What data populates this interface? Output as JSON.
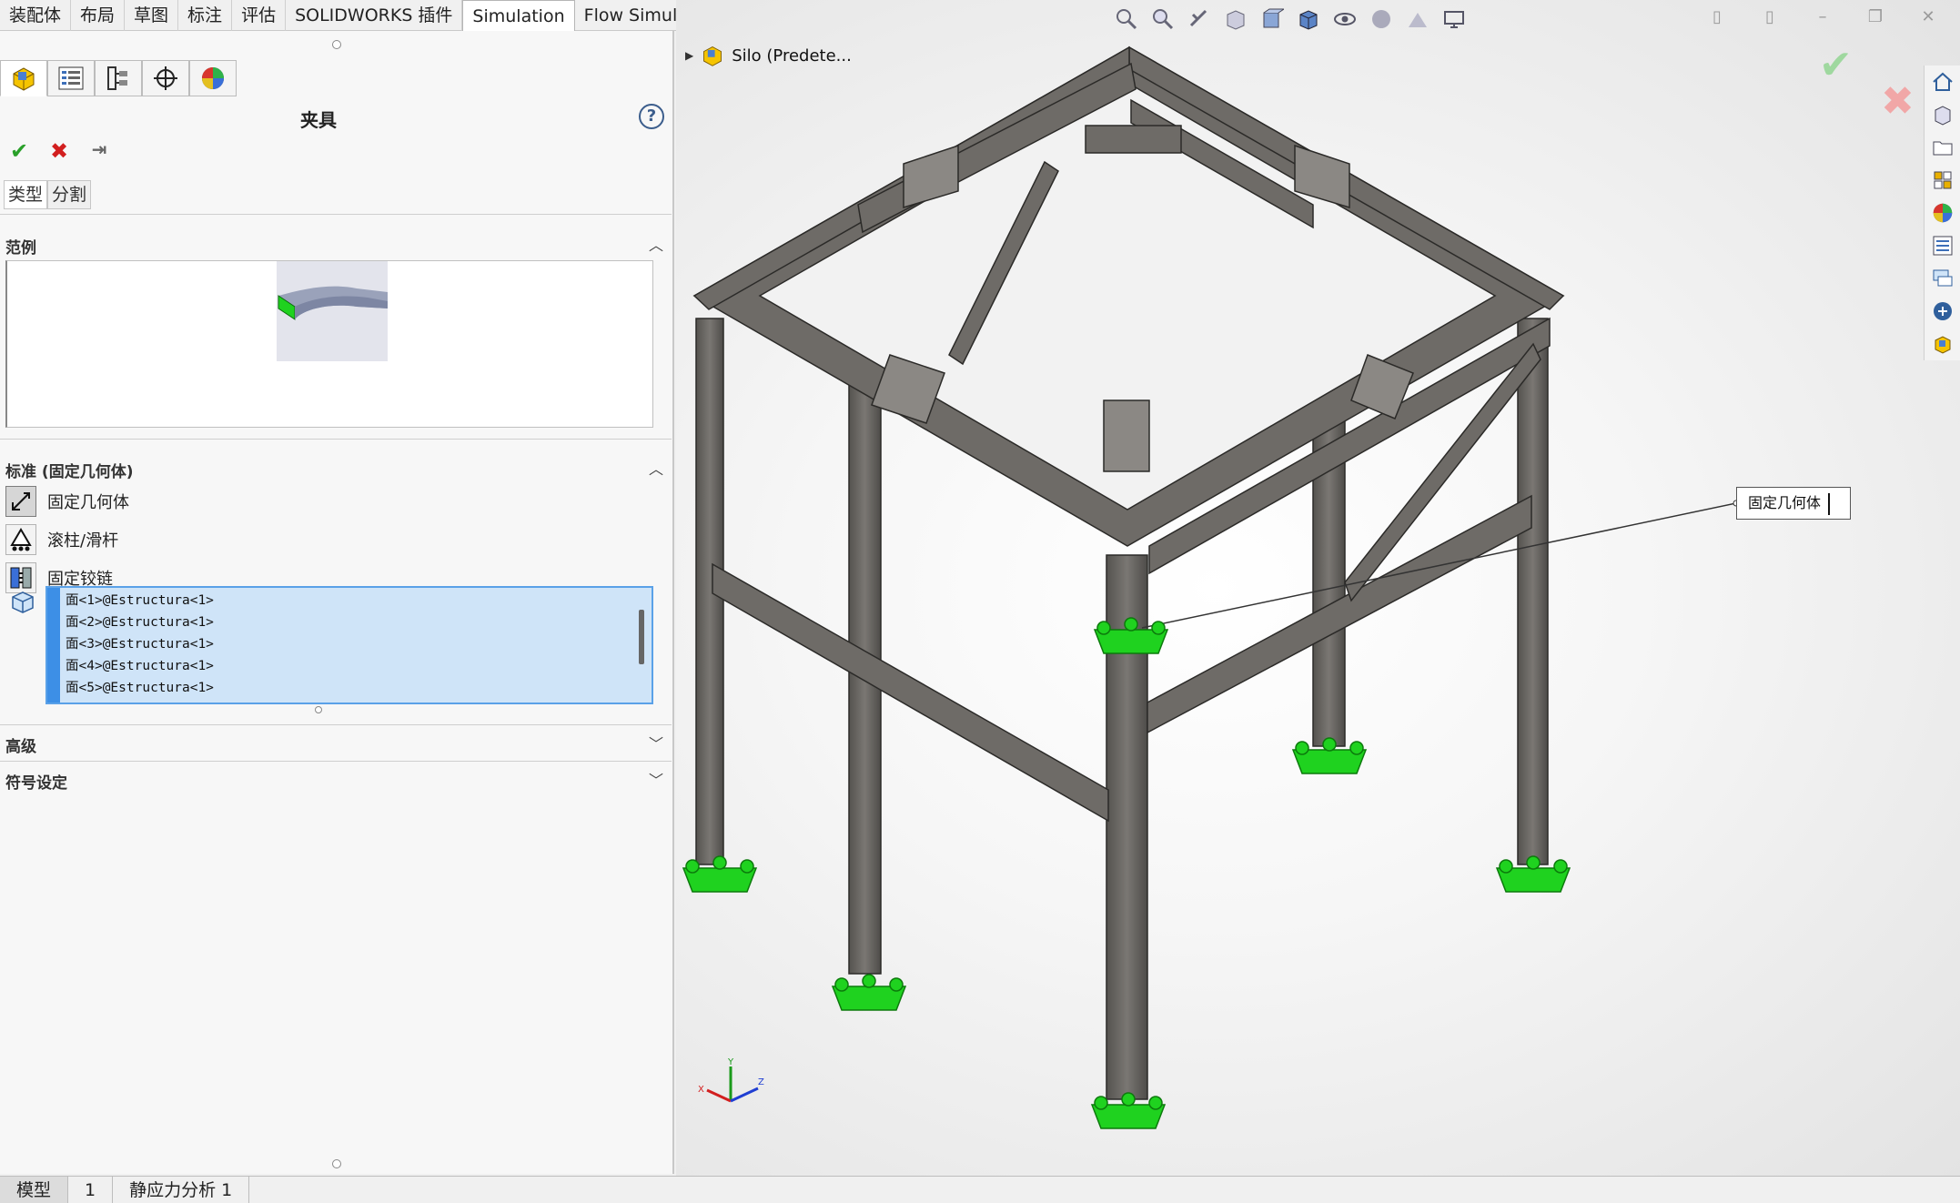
{
  "command_tabs": [
    "装配体",
    "布局",
    "草图",
    "标注",
    "评估",
    "SOLIDWORKS 插件",
    "Simulation",
    "Flow Simulation"
  ],
  "active_command_tab": "Simulation",
  "property_manager": {
    "title": "夹具",
    "help": "?",
    "subtabs": [
      "类型",
      "分割"
    ],
    "sections": {
      "example": "范例",
      "standard": "标准 (固定几何体)",
      "advanced": "高级",
      "symbol": "符号设定"
    },
    "fixture_types": [
      "固定几何体",
      "滚柱/滑杆",
      "固定铰链"
    ],
    "selected_faces": [
      "面<1>@Estructura<1>",
      "面<2>@Estructura<1>",
      "面<3>@Estructura<1>",
      "面<4>@Estructura<1>",
      "面<5>@Estructura<1>"
    ]
  },
  "viewport": {
    "tree_root": "Silo (Predete...",
    "callout": "固定几何体",
    "triad_axes": {
      "x": "X",
      "y": "Y",
      "z": "Z"
    }
  },
  "bottom_tabs": [
    "模型",
    "1",
    "静应力分析 1"
  ],
  "colors": {
    "fixture_green": "#1fd21f",
    "steel": "#6b6966",
    "selection_blue": "#cfe4f8",
    "accent_blue": "#3d8fe6"
  }
}
